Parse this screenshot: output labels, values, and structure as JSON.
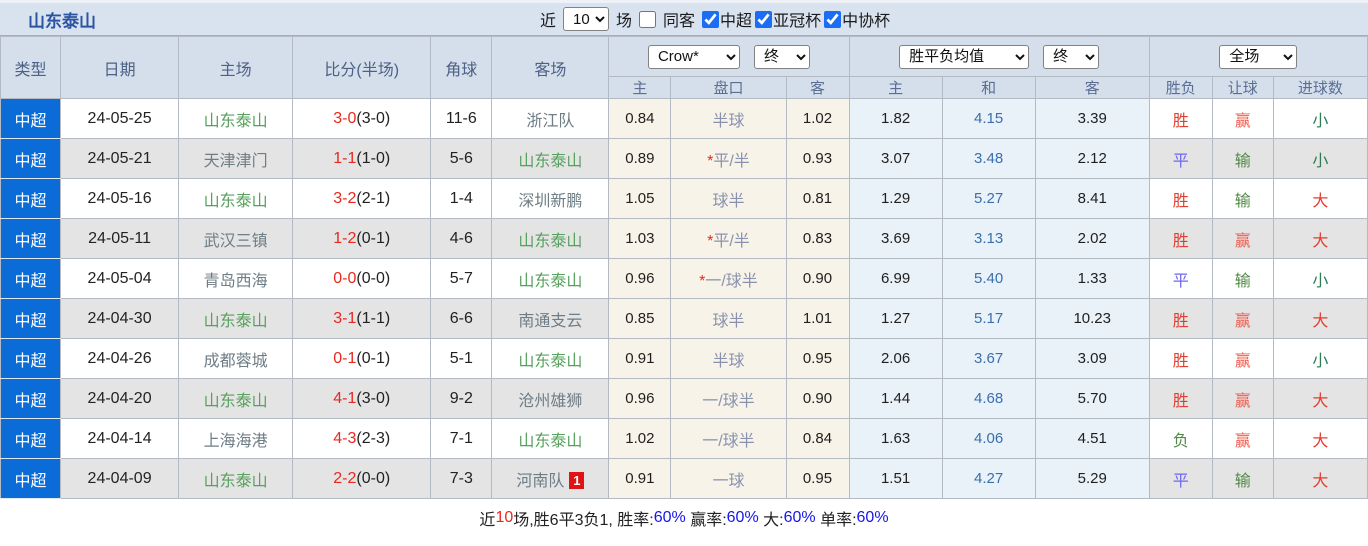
{
  "top_bar": {
    "title": "山东泰山",
    "recent_label": "近",
    "recent_value": "10",
    "unit_label": "场",
    "filters": [
      {
        "label": "同客",
        "checked": false
      },
      {
        "label": "中超",
        "checked": true
      },
      {
        "label": "亚冠杯",
        "checked": true
      },
      {
        "label": "中协杯",
        "checked": true
      }
    ]
  },
  "table": {
    "main_headers": [
      "类型",
      "日期",
      "主场",
      "比分(半场)",
      "角球",
      "客场"
    ],
    "asia_odds_dropdown": "Crow*",
    "asia_status_dropdown": "终",
    "europe_odds_dropdown": "胜平负均值",
    "europe_status_dropdown": "终",
    "scope_dropdown": "全场",
    "sub_headers": [
      "主",
      "盘口",
      "客",
      "主",
      "和",
      "客",
      "胜负",
      "让球",
      "进球数"
    ],
    "rows": [
      {
        "league": "中超",
        "date": "24-05-25",
        "home": {
          "name": "山东泰山",
          "is_focus": true
        },
        "score": "3-0",
        "half": "(3-0)",
        "corners": "11-6",
        "away": {
          "name": "浙江队",
          "is_focus": false,
          "badge": ""
        },
        "asia": {
          "home": "0.84",
          "star": "",
          "line": "半球",
          "away": "1.02"
        },
        "europe": {
          "home": "1.82",
          "draw": "4.15",
          "away": "3.39"
        },
        "outcome": {
          "text": "胜",
          "color": "red"
        },
        "handicap_result": {
          "text": "赢",
          "color": "pink"
        },
        "goals": {
          "text": "小",
          "color": "teal"
        }
      },
      {
        "league": "中超",
        "date": "24-05-21",
        "home": {
          "name": "天津津门",
          "is_focus": false
        },
        "score": "1-1",
        "half": "(1-0)",
        "corners": "5-6",
        "away": {
          "name": "山东泰山",
          "is_focus": true,
          "badge": ""
        },
        "asia": {
          "home": "0.89",
          "star": "*",
          "line": "平/半",
          "away": "0.93"
        },
        "europe": {
          "home": "3.07",
          "draw": "3.48",
          "away": "2.12"
        },
        "outcome": {
          "text": "平",
          "color": "blue"
        },
        "handicap_result": {
          "text": "输",
          "color": "green"
        },
        "goals": {
          "text": "小",
          "color": "teal"
        }
      },
      {
        "league": "中超",
        "date": "24-05-16",
        "home": {
          "name": "山东泰山",
          "is_focus": true
        },
        "score": "3-2",
        "half": "(2-1)",
        "corners": "1-4",
        "away": {
          "name": "深圳新鹏",
          "is_focus": false,
          "badge": ""
        },
        "asia": {
          "home": "1.05",
          "star": "",
          "line": "球半",
          "away": "0.81"
        },
        "europe": {
          "home": "1.29",
          "draw": "5.27",
          "away": "8.41"
        },
        "outcome": {
          "text": "胜",
          "color": "red"
        },
        "handicap_result": {
          "text": "输",
          "color": "green"
        },
        "goals": {
          "text": "大",
          "color": "red"
        }
      },
      {
        "league": "中超",
        "date": "24-05-11",
        "home": {
          "name": "武汉三镇",
          "is_focus": false
        },
        "score": "1-2",
        "half": "(0-1)",
        "corners": "4-6",
        "away": {
          "name": "山东泰山",
          "is_focus": true,
          "badge": ""
        },
        "asia": {
          "home": "1.03",
          "star": "*",
          "line": "平/半",
          "away": "0.83"
        },
        "europe": {
          "home": "3.69",
          "draw": "3.13",
          "away": "2.02"
        },
        "outcome": {
          "text": "胜",
          "color": "red"
        },
        "handicap_result": {
          "text": "赢",
          "color": "pink"
        },
        "goals": {
          "text": "大",
          "color": "red"
        }
      },
      {
        "league": "中超",
        "date": "24-05-04",
        "home": {
          "name": "青岛西海",
          "is_focus": false
        },
        "score": "0-0",
        "half": "(0-0)",
        "corners": "5-7",
        "away": {
          "name": "山东泰山",
          "is_focus": true,
          "badge": ""
        },
        "asia": {
          "home": "0.96",
          "star": "*",
          "line": "一/球半",
          "away": "0.90"
        },
        "europe": {
          "home": "6.99",
          "draw": "5.40",
          "away": "1.33"
        },
        "outcome": {
          "text": "平",
          "color": "blue"
        },
        "handicap_result": {
          "text": "输",
          "color": "green"
        },
        "goals": {
          "text": "小",
          "color": "teal"
        }
      },
      {
        "league": "中超",
        "date": "24-04-30",
        "home": {
          "name": "山东泰山",
          "is_focus": true
        },
        "score": "3-1",
        "half": "(1-1)",
        "corners": "6-6",
        "away": {
          "name": "南通支云",
          "is_focus": false,
          "badge": ""
        },
        "asia": {
          "home": "0.85",
          "star": "",
          "line": "球半",
          "away": "1.01"
        },
        "europe": {
          "home": "1.27",
          "draw": "5.17",
          "away": "10.23"
        },
        "outcome": {
          "text": "胜",
          "color": "red"
        },
        "handicap_result": {
          "text": "赢",
          "color": "pink"
        },
        "goals": {
          "text": "大",
          "color": "red"
        }
      },
      {
        "league": "中超",
        "date": "24-04-26",
        "home": {
          "name": "成都蓉城",
          "is_focus": false
        },
        "score": "0-1",
        "half": "(0-1)",
        "corners": "5-1",
        "away": {
          "name": "山东泰山",
          "is_focus": true,
          "badge": ""
        },
        "asia": {
          "home": "0.91",
          "star": "",
          "line": "半球",
          "away": "0.95"
        },
        "europe": {
          "home": "2.06",
          "draw": "3.67",
          "away": "3.09"
        },
        "outcome": {
          "text": "胜",
          "color": "red"
        },
        "handicap_result": {
          "text": "赢",
          "color": "pink"
        },
        "goals": {
          "text": "小",
          "color": "teal"
        }
      },
      {
        "league": "中超",
        "date": "24-04-20",
        "home": {
          "name": "山东泰山",
          "is_focus": true
        },
        "score": "4-1",
        "half": "(3-0)",
        "corners": "9-2",
        "away": {
          "name": "沧州雄狮",
          "is_focus": false,
          "badge": ""
        },
        "asia": {
          "home": "0.96",
          "star": "",
          "line": "一/球半",
          "away": "0.90"
        },
        "europe": {
          "home": "1.44",
          "draw": "4.68",
          "away": "5.70"
        },
        "outcome": {
          "text": "胜",
          "color": "red"
        },
        "handicap_result": {
          "text": "赢",
          "color": "pink"
        },
        "goals": {
          "text": "大",
          "color": "red"
        }
      },
      {
        "league": "中超",
        "date": "24-04-14",
        "home": {
          "name": "上海海港",
          "is_focus": false
        },
        "score": "4-3",
        "half": "(2-3)",
        "corners": "7-1",
        "away": {
          "name": "山东泰山",
          "is_focus": true,
          "badge": ""
        },
        "asia": {
          "home": "1.02",
          "star": "",
          "line": "一/球半",
          "away": "0.84"
        },
        "europe": {
          "home": "1.63",
          "draw": "4.06",
          "away": "4.51"
        },
        "outcome": {
          "text": "负",
          "color": "green"
        },
        "handicap_result": {
          "text": "赢",
          "color": "pink"
        },
        "goals": {
          "text": "大",
          "color": "red"
        }
      },
      {
        "league": "中超",
        "date": "24-04-09",
        "home": {
          "name": "山东泰山",
          "is_focus": true
        },
        "score": "2-2",
        "half": "(0-0)",
        "corners": "7-3",
        "away": {
          "name": "河南队",
          "is_focus": false,
          "badge": "1"
        },
        "asia": {
          "home": "0.91",
          "star": "",
          "line": "一球",
          "away": "0.95"
        },
        "europe": {
          "home": "1.51",
          "draw": "4.27",
          "away": "5.29"
        },
        "outcome": {
          "text": "平",
          "color": "blue"
        },
        "handicap_result": {
          "text": "输",
          "color": "green"
        },
        "goals": {
          "text": "大",
          "color": "red"
        }
      }
    ]
  },
  "footer": {
    "t1": "近",
    "n1": "10",
    "t2": "场,胜6平3负1, 胜率:",
    "v1": "60%",
    "t3": " 赢率:",
    "v2": "60%",
    "t4": " 大:",
    "v3": "60%",
    "t5": " 单率:",
    "v4": "60%"
  },
  "colors": {
    "league_cell_blue": "#0b6cd8",
    "focus_team_green": "#57a05e",
    "opponent_gray": "#6e7d86",
    "score_red": "#e8281e",
    "draw_odds_blue": "#3a6fae",
    "win_red": "#e23d2d",
    "handicap_win_red": "#f06052",
    "draw_blue": "#6e67ef",
    "lose_green": "#4f8a44",
    "under_green": "#2d7c55",
    "percent_blue": "#1515e8",
    "asia_section_bg": "#f8f3e8",
    "europe_section_bg": "#e9f2f9",
    "topbar_bg": "#d9e3f0"
  }
}
